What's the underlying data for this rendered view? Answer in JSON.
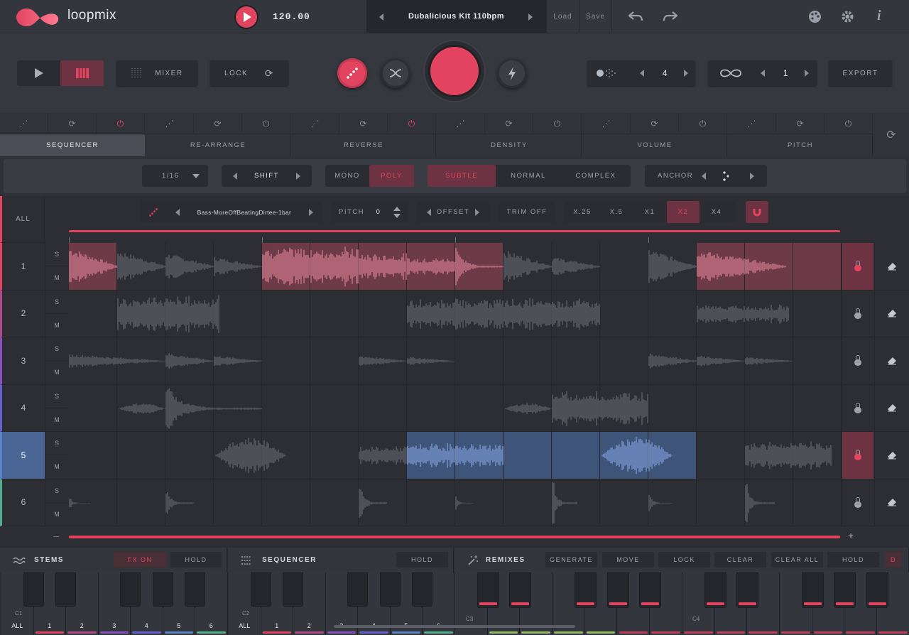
{
  "app": {
    "name": "loopmix",
    "bpm": "120.00",
    "kit": "Dubalicious Kit 110bpm",
    "load": "Load",
    "save": "Save"
  },
  "controls": {
    "mixer": "MIXER",
    "lock": "LOCK",
    "export": "EXPORT",
    "counter1": "4",
    "counter2": "1"
  },
  "tabs": [
    {
      "label": "SEQUENCER"
    },
    {
      "label": "RE-ARRANGE"
    },
    {
      "label": "REVERSE"
    },
    {
      "label": "DENSITY"
    },
    {
      "label": "VOLUME"
    },
    {
      "label": "PITCH"
    }
  ],
  "options": {
    "division": "1/16",
    "shift": "SHIFT",
    "mono": "MONO",
    "poly": "POLY",
    "subtle": "SUBTLE",
    "normal": "NORMAL",
    "complex": "COMPLEX",
    "anchor": "ANCHOR"
  },
  "sample": {
    "all": "ALL",
    "name": "Bass-MoreOffBeatingDirtee-1bar",
    "pitch_label": "PITCH",
    "pitch_value": "0",
    "offset": "OFFSET",
    "trim": "TRIM OFF",
    "x025": "X.25",
    "x05": "X.5",
    "x1": "X1",
    "x2": "X2",
    "x4": "X4"
  },
  "tracks": [
    {
      "n": "1",
      "s": "S",
      "m": "M",
      "color": "#e2445f"
    },
    {
      "n": "2",
      "s": "S",
      "m": "M",
      "color": "#b04a8f"
    },
    {
      "n": "3",
      "s": "S",
      "m": "M",
      "color": "#8a4fc0"
    },
    {
      "n": "4",
      "s": "S",
      "m": "M",
      "color": "#6a5fd0"
    },
    {
      "n": "5",
      "s": "S",
      "m": "M",
      "color": "#5a82c8"
    },
    {
      "n": "6",
      "s": "S",
      "m": "M",
      "color": "#4fb08a"
    }
  ],
  "bottom": {
    "stems": "STEMS",
    "fx_on": "FX ON",
    "hold": "HOLD",
    "sequencer": "SEQUENCER",
    "seq_hold": "HOLD",
    "remixes": "REMIXES",
    "generate": "GENERATE",
    "move": "MOVE",
    "lock": "LOCK",
    "clear": "CLEAR",
    "clear_all": "CLEAR ALL",
    "rhold": "HOLD",
    "d": "D",
    "octave1": "C1",
    "octave2": "C2",
    "octave3": "C3",
    "octave4": "C4",
    "all": "ALL",
    "keys": [
      "1",
      "2",
      "3",
      "4",
      "5",
      "6"
    ]
  }
}
